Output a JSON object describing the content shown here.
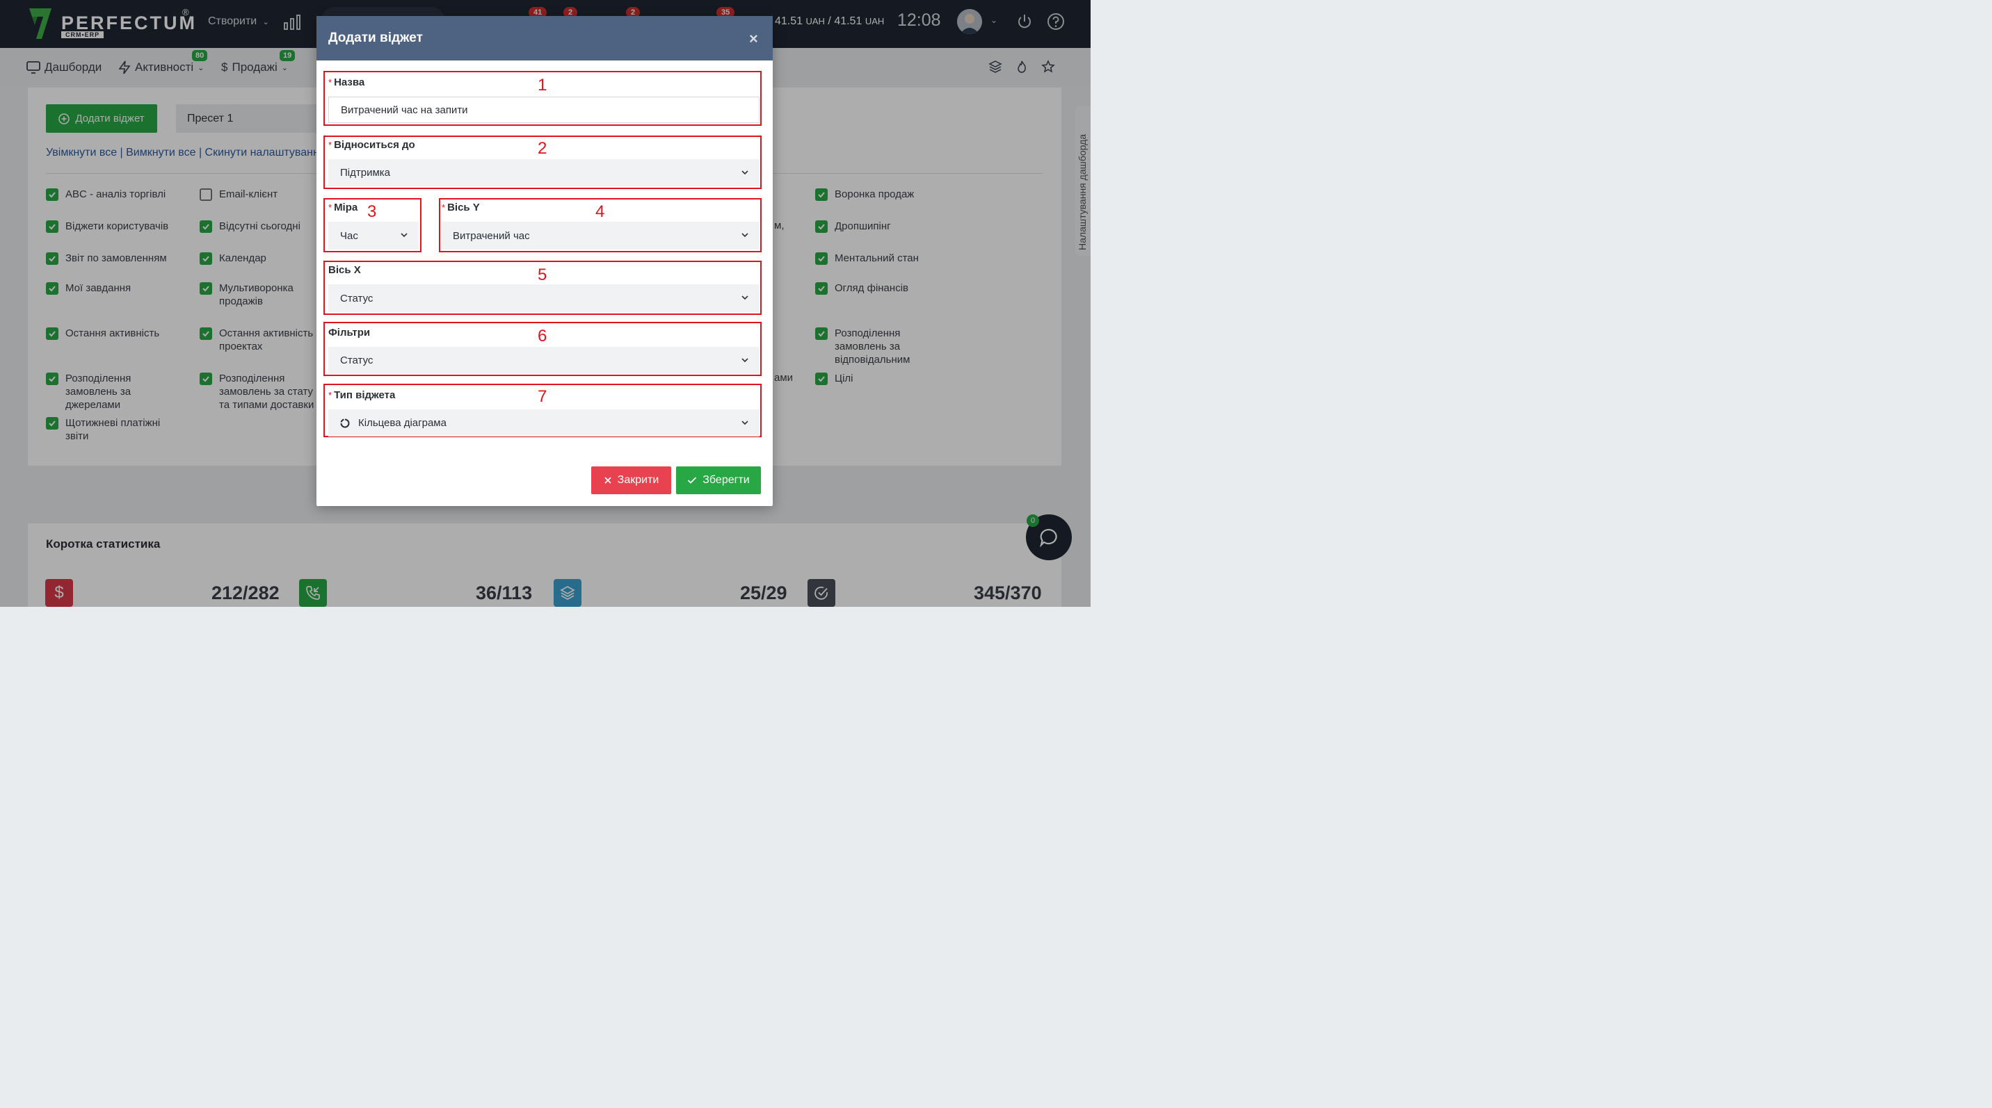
{
  "topbar": {
    "logo_text": "PERFECTUM",
    "logo_reg": "®",
    "logo_sub": "CRM•ERP",
    "create_label": "Створити",
    "badges": [
      "41",
      "2",
      "2",
      "35"
    ],
    "balance_value1": "41.51",
    "balance_currency1": "UAH",
    "balance_sep": "/",
    "balance_value2": "41.51",
    "balance_currency2": "UAH",
    "time": "12:08"
  },
  "nav": {
    "dashboards": "Дашборди",
    "activities": "Активності",
    "activities_badge": "80",
    "sales": "Продажі",
    "sales_badge": "19"
  },
  "card": {
    "add_widget": "Додати віджет",
    "preset": "Пресет 1",
    "links": "Увімкнути все | Вимкнути все | Скинути налаштування",
    "side_tab": "Налаштування дашборда",
    "checkboxes": [
      {
        "label": "ABC - аналіз торгівлі",
        "checked": true
      },
      {
        "label": "Email-клієнт",
        "checked": false
      },
      {
        "label": "Воронка продаж",
        "checked": true
      },
      {
        "label": "Віджети користувачів",
        "checked": true
      },
      {
        "label": "Відсутні сьогодні",
        "checked": true
      },
      {
        "label": "Дропшипінг",
        "checked": true
      },
      {
        "label": "Звіт по замовленням",
        "checked": true
      },
      {
        "label": "Календар",
        "checked": true
      },
      {
        "label": "Ментальний стан",
        "checked": true
      },
      {
        "label": "Мої завдання",
        "checked": true
      },
      {
        "label": "Мультиворонка продажів",
        "checked": true
      },
      {
        "label": "Огляд фінансів",
        "checked": true
      },
      {
        "label": "Остання активність",
        "checked": true
      },
      {
        "label": "Остання активність проектах",
        "checked": true
      },
      {
        "label": "Розподілення замовлень за відповідальним",
        "checked": true
      },
      {
        "label": "Розподілення замовлень за джерелами",
        "checked": true
      },
      {
        "label": "Розподілення замовлень за стату та типами доставки",
        "checked": true
      },
      {
        "label": "Цілі",
        "checked": true
      },
      {
        "label": "Щотижневі платіжні звіти",
        "checked": true
      }
    ],
    "partial_texts": [
      "м,",
      "ами"
    ]
  },
  "stats": {
    "title": "Коротка статистика",
    "items": [
      {
        "value": "212/282",
        "icon": "dollar-icon",
        "color": "#d73a49"
      },
      {
        "value": "36/113",
        "icon": "phone-incoming-icon",
        "color": "#28a745"
      },
      {
        "value": "25/29",
        "icon": "layers-icon",
        "color": "#3a9fcf"
      },
      {
        "value": "345/370",
        "icon": "check-circle-icon",
        "color": "#4a4f57"
      }
    ],
    "chat_badge": "0"
  },
  "modal": {
    "title": "Додати віджет",
    "close_symbol": "×",
    "fields": {
      "name": {
        "label": "Назва",
        "number": "1",
        "value": "Витрачений час на запити"
      },
      "relates": {
        "label": "Відноситься до",
        "number": "2",
        "value": "Підтримка"
      },
      "measure": {
        "label": "Міра",
        "number": "3",
        "value": "Час"
      },
      "axis_y": {
        "label": "Вісь Y",
        "number": "4",
        "value": "Витрачений час"
      },
      "axis_x": {
        "label": "Вісь X",
        "number": "5",
        "value": "Статус"
      },
      "filters": {
        "label": "Фільтри",
        "number": "6",
        "value": "Статус"
      },
      "widget_type": {
        "label": "Тип віджета",
        "number": "7",
        "value": "Кільцева діаграма"
      }
    },
    "required_mark": "*",
    "close_button": "Закрити",
    "save_button": "Зберегти"
  },
  "colors": {
    "accent_red": "#e0131f",
    "green": "#28a745",
    "header": "#4e6282"
  }
}
